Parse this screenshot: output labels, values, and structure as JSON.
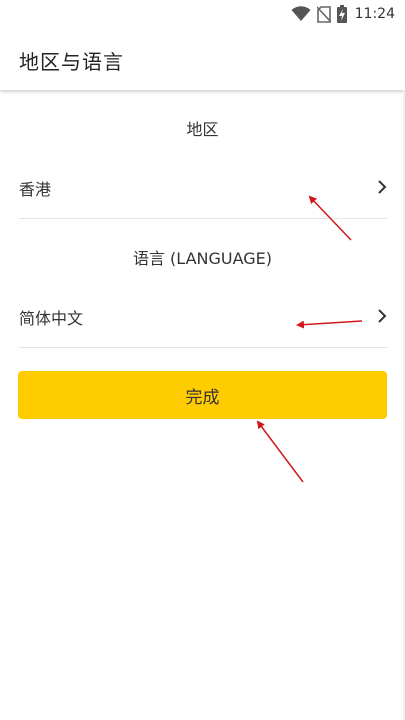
{
  "status_bar": {
    "time": "11:24",
    "icons": [
      "wifi-icon",
      "no-sim-icon",
      "battery-charging-icon"
    ]
  },
  "app_bar": {
    "title": "地区与语言"
  },
  "region": {
    "header": "地区",
    "value": "香港",
    "icon": "chevron-right-icon"
  },
  "language": {
    "header": "语言 (LANGUAGE)",
    "value": "简体中文",
    "icon": "chevron-right-icon"
  },
  "done_button": {
    "label": "完成"
  },
  "colors": {
    "accent": "#ffcc00",
    "annotation_arrow": "#d0181c",
    "divider": "#e4e4e4"
  }
}
